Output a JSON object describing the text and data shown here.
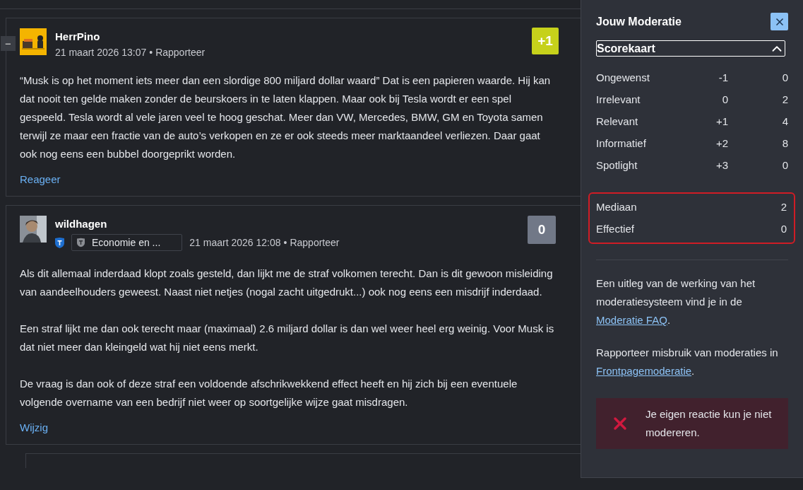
{
  "comments": [
    {
      "collapse": "−",
      "avatar": {
        "kind": "picture"
      },
      "author": "HerrPino",
      "date": "21 maart 2026 13:07",
      "sep": "•",
      "report": "Rapporteer",
      "score": {
        "text": "+1",
        "kind": "positive"
      },
      "paragraphs": [
        "“Musk is op het moment iets meer dan een slordige 800 miljard dollar waard” Dat is een papieren waarde. Hij kan dat nooit ten gelde maken zonder de beurskoers in te laten klappen. Maar ook bij Tesla wordt er een spel gespeeld. Tesla wordt al vele jaren veel te hoog geschat. Meer dan VW, Mercedes, BMW, GM en Toyota samen terwijl ze maar een fractie van de auto’s verkopen en ze er ook steeds meer marktaandeel verliezen. Daar gaat ook nog eens een bubbel doorgeprikt worden."
      ],
      "action": "Reageer"
    },
    {
      "avatar": {
        "kind": "picture"
      },
      "author": "wildhagen",
      "badges": [
        {
          "kind": "shield"
        },
        {
          "kind": "forum",
          "label": "Economie en ..."
        }
      ],
      "date": "21 maart 2026 12:08",
      "sep": "•",
      "report": "Rapporteer",
      "score": {
        "text": "0",
        "kind": "neutral"
      },
      "paragraphs": [
        "Als dit allemaal inderdaad klopt zoals gesteld, dan lijkt me de straf volkomen terecht. Dan is dit gewoon misleiding van aandeelhouders geweest. Naast niet netjes (nogal zacht uitgedrukt...) ook nog eens een misdrijf inderdaad.",
        "Een straf lijkt me dan ook terecht maar (maximaal) 2.6 miljard dollar is dan wel weer heel erg weinig. Voor Musk is dat niet meer dan kleingeld wat hij niet eens merkt.",
        "De vraag is dan ook of deze straf een voldoende afschrikwekkend effect heeft en hij zich bij een eventuele volgende overname van een bedrijf niet weer op soortgelijke wijze gaat misdragen."
      ],
      "action": "Wijzig"
    }
  ],
  "panel": {
    "title": "Jouw Moderatie",
    "scorecard": {
      "title": "Scorekaart",
      "expanded": true,
      "rows": [
        {
          "label": "Ongewenst",
          "value": "-1",
          "count": "0"
        },
        {
          "label": "Irrelevant",
          "value": "0",
          "count": "2"
        },
        {
          "label": "Relevant",
          "value": "+1",
          "count": "4"
        },
        {
          "label": "Informatief",
          "value": "+2",
          "count": "8"
        },
        {
          "label": "Spotlight",
          "value": "+3",
          "count": "0"
        }
      ],
      "totals": [
        {
          "label": "Mediaan",
          "count": "2"
        },
        {
          "label": "Effectief",
          "count": "0"
        }
      ]
    },
    "info": [
      {
        "text": "Een uitleg van de werking van het moderatiesysteem vind je in de ",
        "link": "Moderatie FAQ",
        "after": "."
      },
      {
        "text": "Rapporteer misbruik van moderaties in ",
        "link": "Frontpagemoderatie",
        "after": "."
      }
    ],
    "error": "Je eigen reactie kun je niet modereren."
  }
}
